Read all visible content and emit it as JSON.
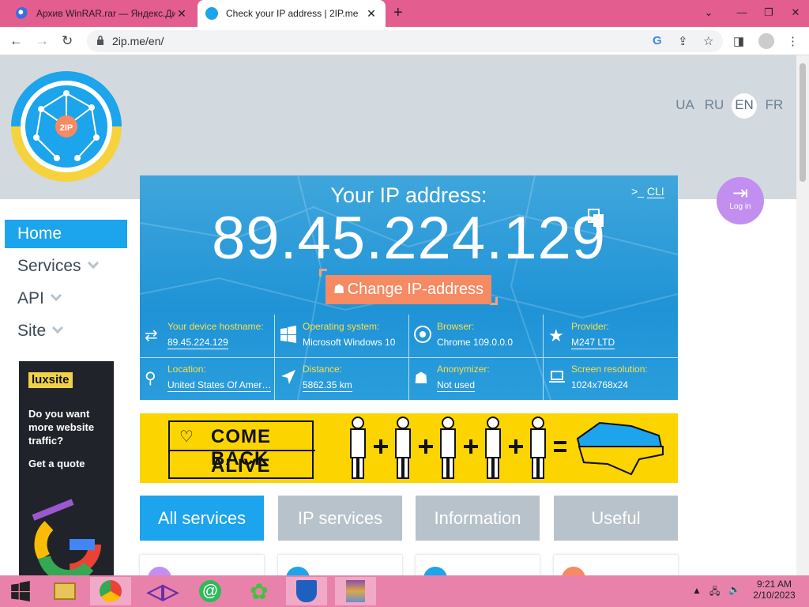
{
  "browser": {
    "tabs": [
      {
        "title": "Архив WinRAR.rar — Яндекс.Ди",
        "active": false
      },
      {
        "title": "Check your IP address | 2IP.me",
        "active": true
      }
    ],
    "url": "2ip.me/en/"
  },
  "site": {
    "logo_text": "2IP",
    "languages": [
      "UA",
      "RU",
      "EN",
      "FR"
    ],
    "active_language": "EN",
    "login_label": "Log in",
    "nav": [
      {
        "label": "Home",
        "active": true
      },
      {
        "label": "Services",
        "dropdown": true
      },
      {
        "label": "API",
        "dropdown": true
      },
      {
        "label": "Site",
        "dropdown": true
      }
    ],
    "ad": {
      "brand": "luxsite",
      "text": "Do you want more website traffic?",
      "cta": "Get a quote"
    },
    "ipbox": {
      "title": "Your IP address:",
      "ip": "89.45.224.129",
      "cli_label": "CLI",
      "change_button": "Change IP-address",
      "info": [
        {
          "label": "Your device hostname:",
          "value": "89.45.224.129",
          "link": true,
          "icon": "swap-icon"
        },
        {
          "label": "Operating system:",
          "value": "Microsoft Windows 10",
          "link": false,
          "icon": "windows-icon"
        },
        {
          "label": "Browser:",
          "value": "Chrome 109.0.0.0",
          "link": false,
          "icon": "chrome-icon"
        },
        {
          "label": "Provider:",
          "value": "M247 LTD",
          "link": true,
          "icon": "star-icon"
        },
        {
          "label": "Location:",
          "value": "United States Of Amer…",
          "link": true,
          "icon": "location-pin-icon"
        },
        {
          "label": "Distance:",
          "value": "5862.35 km",
          "link": true,
          "icon": "navigation-icon"
        },
        {
          "label": "Anonymizer:",
          "value": "Not used",
          "link": true,
          "icon": "spy-icon"
        },
        {
          "label": "Screen resolution:",
          "value": "1024x768x24",
          "link": false,
          "icon": "laptop-icon"
        }
      ]
    },
    "banner": {
      "line1": "COME BACK",
      "line2": "ALIVE"
    },
    "service_tabs": [
      {
        "label": "All services",
        "active": true
      },
      {
        "label": "IP services",
        "active": false
      },
      {
        "label": "Information",
        "active": false
      },
      {
        "label": "Useful",
        "active": false
      }
    ]
  },
  "taskbar": {
    "time": "9:21 AM",
    "date": "2/10/2023"
  },
  "colors": {
    "tabbar": "#e35d8f",
    "accent_blue": "#1ca4ec",
    "change_button": "#f58a63",
    "banner_yellow": "#fcd500",
    "info_label": "#f4e04e"
  }
}
